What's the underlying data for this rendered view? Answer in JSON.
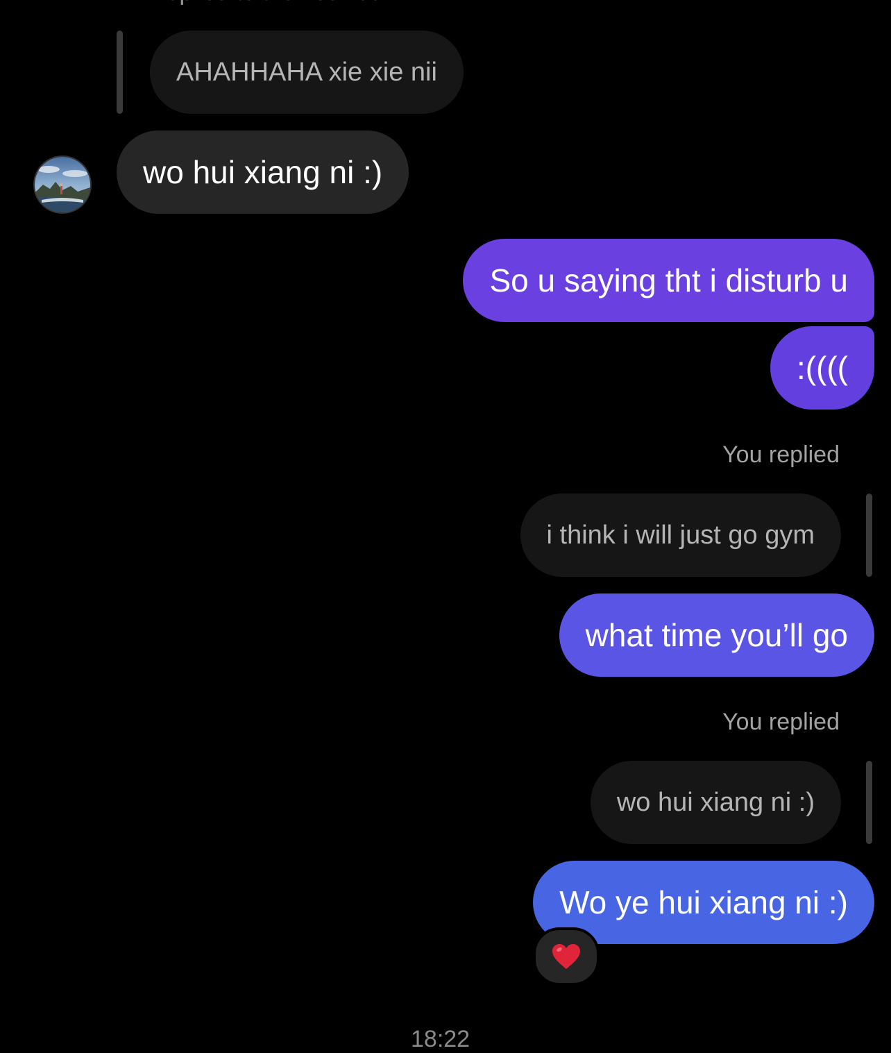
{
  "thread": {
    "top_reply_label": "Replied to themselves",
    "quoted_1": "AHAHHAHA xie xie nii",
    "incoming_1": "wo hui xiang ni :)",
    "outgoing_1": "So u saying tht i disturb u",
    "outgoing_2": ":((((",
    "you_replied_1": "You replied",
    "quoted_2": "i think i will just go gym",
    "outgoing_3": "what time you’ll go",
    "you_replied_2": "You replied",
    "quoted_3": "wo hui xiang ni :)",
    "outgoing_4": "Wo ye hui xiang ni :)",
    "reaction_emoji": "heart",
    "timestamp": "18:22"
  },
  "colors": {
    "background": "#000000",
    "incoming_bubble": "#262626",
    "quoted_bubble": "#161616",
    "outgoing_gradient": [
      "#6a41e0",
      "#5e4ee3",
      "#5160e6",
      "#4767e6"
    ]
  }
}
